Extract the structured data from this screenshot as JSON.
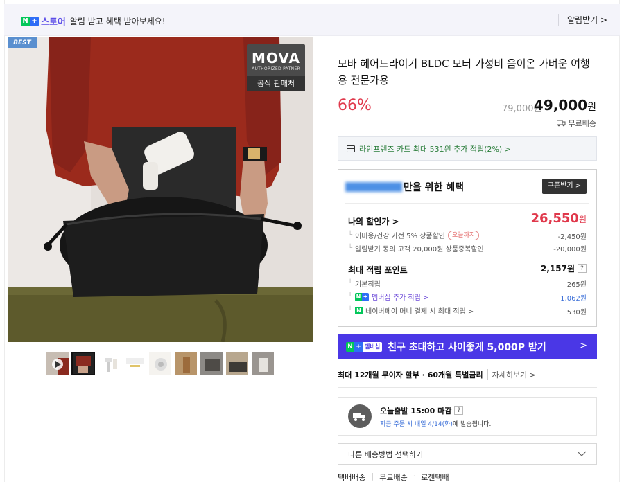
{
  "notice": {
    "brand": "스토어",
    "text": "알림 받고 혜택 받아보세요!",
    "button": "알림받기 >"
  },
  "hero": {
    "best_tag": "BEST",
    "mova_logo": "MOVA",
    "mova_sub": "AUTHORIZED PATNER",
    "mova_official": "공식 판매처"
  },
  "thumbnails": [
    {
      "name": "video",
      "active": false
    },
    {
      "name": "thumb-2",
      "active": true
    },
    {
      "name": "thumb-3",
      "active": false
    },
    {
      "name": "thumb-4",
      "active": false
    },
    {
      "name": "thumb-5",
      "active": false
    },
    {
      "name": "thumb-6",
      "active": false
    },
    {
      "name": "thumb-7",
      "active": false
    },
    {
      "name": "thumb-8",
      "active": false
    },
    {
      "name": "thumb-9",
      "active": false
    }
  ],
  "product": {
    "title": "모바 헤어드라이기 BLDC 모터 가성비 음이온 가벼운 여행용 전문가용",
    "discount": "66%",
    "original_price": "79,000원",
    "sale_price": "49,000",
    "sale_unit": "원",
    "shipping": "무료배송"
  },
  "card_benefit": "라인프렌즈 카드 최대 531원 추가 적립(2%) >",
  "benefit": {
    "head_suffix": "만을 위한 혜택",
    "coupon_button": "쿠폰받기 >",
    "my_discount_label": "나의 할인가 >",
    "my_discount_value": "26,550",
    "my_discount_unit": "원",
    "sub1_label": "이미용/건강 가전 5% 상품할인",
    "sub1_tag": "오늘까지",
    "sub1_value": "-2,450원",
    "sub2_label": "알림받기 동의 고객 20,000원 상품중복할인",
    "sub2_value": "-20,000원",
    "points_label": "최대 적립 포인트",
    "points_value": "2,157원",
    "base_label": "기본적립",
    "base_value": "265원",
    "member_label": "멤버십 추가 적립 >",
    "member_value": "1,062원",
    "npay_label": "네이버페이 머니 결제 시 최대 적립 >",
    "npay_value": "530원"
  },
  "promo": {
    "badge": "멤버십",
    "text": "친구 초대하고 사이좋게 5,000P 받기",
    "arrow": ">"
  },
  "installment": {
    "text": "최대 12개월 무이자 할부 · 60개월 특별금리",
    "more": "자세히보기 >"
  },
  "delivery": {
    "line1": "오늘출발 15:00 마감",
    "line2_prefix": "지금 주문 시",
    "line2_date": "내일 4/14(화)",
    "line2_suffix": "에 발송됩니다."
  },
  "ship_select": "다른 배송방법 선택하기",
  "ship_methods": [
    "택배배송",
    "무료배송",
    "로젠택배"
  ],
  "colors": {
    "accent_red": "#e0394c",
    "promo_purple": "#4a37e6",
    "naver_green": "#03c75a"
  }
}
